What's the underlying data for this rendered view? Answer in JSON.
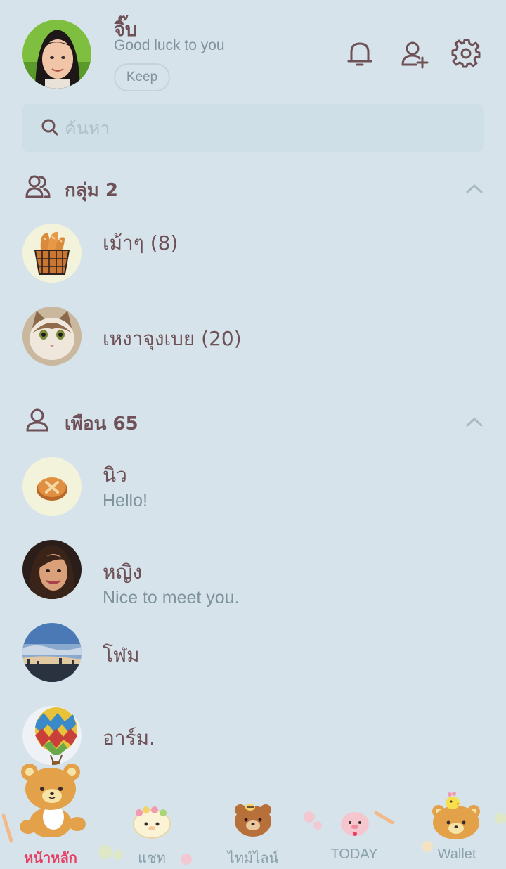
{
  "profile": {
    "name": "จิ๊บ",
    "status": "Good luck to you",
    "keep_label": "Keep"
  },
  "header_icons": [
    "bell-icon",
    "add-friend-icon",
    "settings-gear-icon"
  ],
  "search": {
    "placeholder": "ค้นหา"
  },
  "groups": {
    "title": "กลุ่ม 2",
    "items": [
      {
        "name": "เม้าๆ (8)",
        "avatar": "bread-basket-avatar"
      },
      {
        "name": "เหงาจุงเบย (20)",
        "avatar": "cat-photo-avatar"
      }
    ]
  },
  "friends": {
    "title": "เพือน 65",
    "items": [
      {
        "name": "นิว",
        "status": "Hello!",
        "avatar": "pancake-avatar"
      },
      {
        "name": "หญิง",
        "status": "Nice to meet you.",
        "avatar": "woman-photo-avatar"
      },
      {
        "name": "โฬม",
        "status": "",
        "avatar": "sky-photo-avatar"
      },
      {
        "name": "อาร์ม.",
        "status": "",
        "avatar": "balloon-photo-avatar"
      }
    ]
  },
  "nav": {
    "items": [
      {
        "label": "หน้าหลัก",
        "active": true
      },
      {
        "label": "แชท",
        "active": false
      },
      {
        "label": "ไทม์ไลน์",
        "active": false
      },
      {
        "label": "TODAY",
        "active": false
      },
      {
        "label": "Wallet",
        "active": false
      }
    ]
  },
  "colors": {
    "background": "#d6e3eb",
    "text": "#6e5156",
    "muted": "#7e939c",
    "active_tab": "#e64065"
  }
}
